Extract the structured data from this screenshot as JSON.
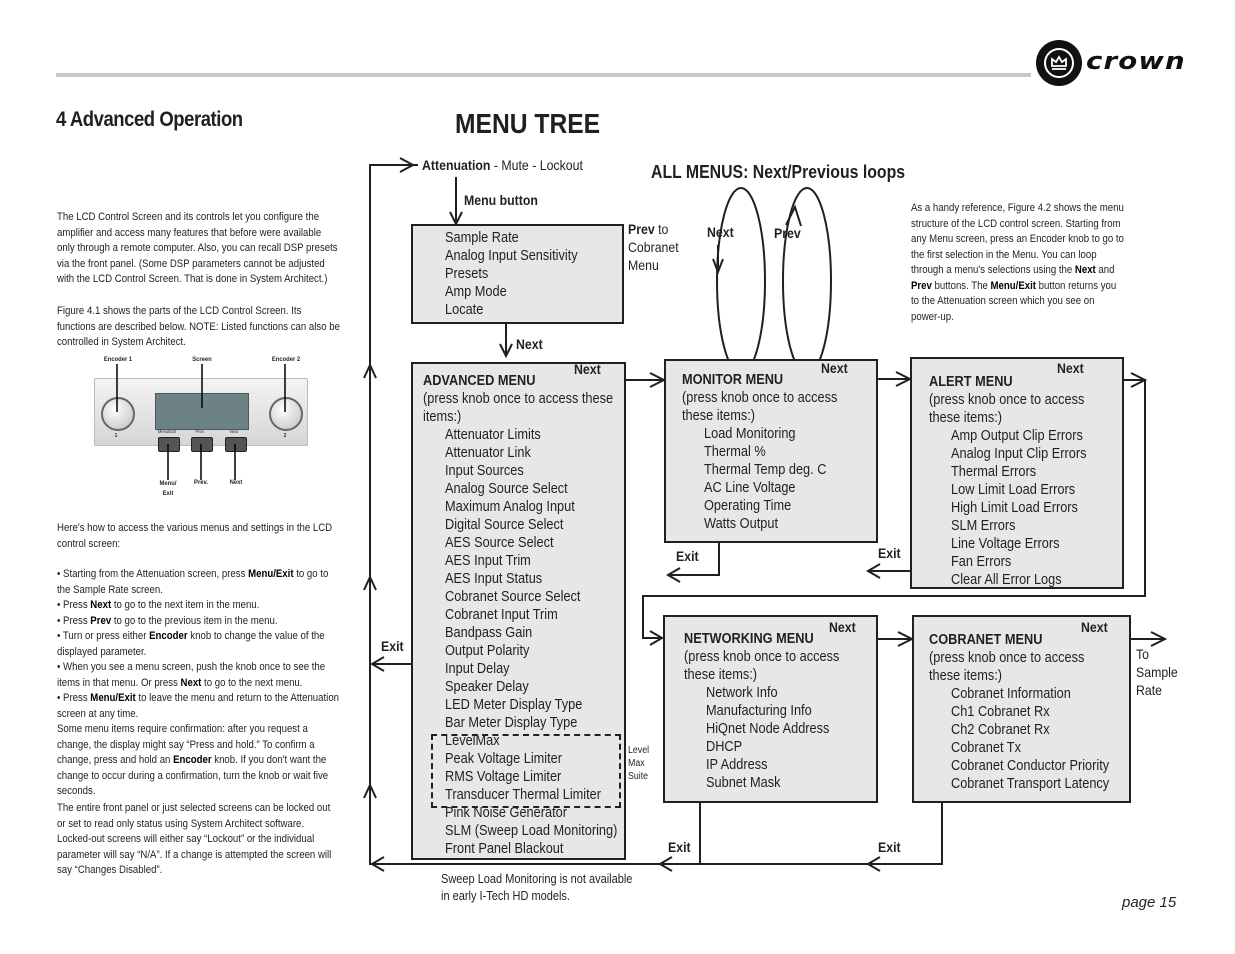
{
  "header": {
    "brand": "crown",
    "section_title": "4 Advanced Operation",
    "figure_title": "MENU TREE"
  },
  "left_column": {
    "intro": "The LCD Control Screen and its controls let you configure the amplifier and access many features that before were available only through a remote computer. Also, you can recall DSP presets via the front panel. (Some DSP parameters cannot be adjusted with the LCD Control Screen. That is done in System Architect.)",
    "figure_note": "Figure 4.1 shows the parts of the LCD Control Screen. Its functions are described below. NOTE: Listed functions can also be controlled in System Architect.",
    "figure": {
      "labels": {
        "encoder1": "Encoder 1",
        "screen": "Screen",
        "encoder2": "Encoder 2",
        "menu_exit": "Menu/ Exit",
        "prev": "Prev.",
        "next": "Next"
      },
      "panel_button_labels": [
        "Menu/Exit",
        "Prev.",
        "Next"
      ],
      "knob_numbers": [
        "1",
        "2"
      ]
    },
    "howto_intro": "Here's how to access the various menus and settings in the LCD control screen:",
    "bullets": [
      {
        "pre": "• Starting from the Attenuation screen, press ",
        "bold": "Menu/Exit",
        "post": " to go to the Sample Rate screen."
      },
      {
        "pre": "• Press ",
        "bold": "Next",
        "post": " to go to the next item in the menu."
      },
      {
        "pre": "• Press ",
        "bold": "Prev",
        "post": " to go to the previous item in the menu."
      },
      {
        "pre": "• Turn or press either ",
        "bold": "Encoder",
        "post": " knob to change the value of the displayed parameter."
      },
      {
        "pre": "• When you see a menu screen, push the knob once to see the items in that menu. Or press ",
        "bold": "Next",
        "post": " to go to the next menu."
      },
      {
        "pre": "• Press ",
        "bold": "Menu/Exit",
        "post": " to leave the menu and return to the Attenuation screen at any time."
      }
    ],
    "confirm": {
      "pre": "Some menu items require confirmation: after you request a change, the display might say “Press and hold.” To confirm a change, press and hold an ",
      "bold": "Encoder",
      "post": " knob. If you don't want the change to occur during a confirmation, turn the knob or wait five seconds."
    },
    "lockout": "The entire front panel or just selected screens can be locked out or set to read only status using System Architect software. Locked-out screens will either say “Lockout” or the individual parameter will say “N/A”. If a change is attempted the screen will say “Changes Disabled”."
  },
  "reference": {
    "p1": "As a handy reference, Figure 4.2 shows the menu structure of the LCD control screen. Starting from any Menu screen, press an Encoder knob to go to the first selection in the Menu. You can loop through a menu's selections using the ",
    "b1": "Next",
    "p2": " and ",
    "b2": "Prev",
    "p3": " buttons. The ",
    "b3": "Menu/Exit",
    "p4": " button returns you to the Attenuation screen which you see on power-up."
  },
  "tree": {
    "attenuation_bold": "Attenuation",
    "attenuation_rest": " - Mute - Lockout",
    "menu_button": "Menu button",
    "loops_title": "ALL MENUS: Next/Previous loops",
    "loop_next": "Next",
    "loop_prev": "Prev",
    "prev_to_bold": "Prev",
    "prev_to_rest": " to",
    "prev_to_lines": [
      "Cobranet",
      "Menu"
    ],
    "next_label": "Next",
    "exit_label": "Exit",
    "to_sample_rate": [
      "To",
      "Sample",
      "Rate"
    ],
    "levelmax_suite": [
      "Level",
      "Max",
      "Suite"
    ],
    "slm_note": [
      "Sweep Load Monitoring is not available",
      "in early I-Tech HD models."
    ],
    "top_box": [
      "Sample Rate",
      "Analog Input Sensitivity",
      "Presets",
      "Amp Mode",
      "Locate"
    ],
    "press_knob": "(press knob once to access",
    "these_items": "these items:)",
    "advanced": {
      "title": "ADVANCED MENU",
      "desc1": "(press knob once to access these",
      "desc2": " items:)",
      "items": [
        "Attenuator Limits",
        "Attenuator Link",
        "Input Sources",
        "Analog Source Select",
        "Maximum Analog Input",
        "Digital Source Select",
        "AES Source Select",
        "AES Input Trim",
        "AES Input Status",
        "Cobranet Source Select",
        "Cobranet Input Trim",
        "Bandpass Gain",
        "Output Polarity",
        "Input Delay",
        "Speaker Delay",
        "LED Meter Display Type",
        "Bar Meter Display Type",
        "LevelMax",
        "Peak Voltage Limiter",
        "RMS Voltage Limiter",
        "Transducer Thermal Limiter",
        "Pink Noise Generator",
        "SLM (Sweep Load Monitoring)",
        "Front Panel Blackout"
      ]
    },
    "monitor": {
      "title": "MONITOR MENU",
      "items": [
        "Load Monitoring",
        "Thermal %",
        "Thermal Temp deg. C",
        "AC Line Voltage",
        "Operating Time",
        "Watts Output"
      ]
    },
    "alert": {
      "title": "ALERT MENU",
      "items": [
        "Amp Output Clip Errors",
        "Analog Input Clip Errors",
        "Thermal Errors",
        "Low Limit Load Errors",
        "High Limit Load Errors",
        "SLM Errors",
        "Line Voltage Errors",
        "Fan Errors",
        "Clear All Error Logs"
      ]
    },
    "networking": {
      "title": "NETWORKING MENU",
      "items": [
        "Network Info",
        "Manufacturing Info",
        "HiQnet Node Address",
        "DHCP",
        "IP Address",
        "Subnet Mask"
      ]
    },
    "cobranet": {
      "title": "COBRANET MENU",
      "items": [
        "Cobranet Information",
        "Ch1 Cobranet Rx",
        "Ch2 Cobranet Rx",
        "Cobranet Tx",
        "Cobranet Conductor Priority",
        "Cobranet Transport Latency"
      ]
    }
  },
  "footer": {
    "page": "page 15"
  }
}
